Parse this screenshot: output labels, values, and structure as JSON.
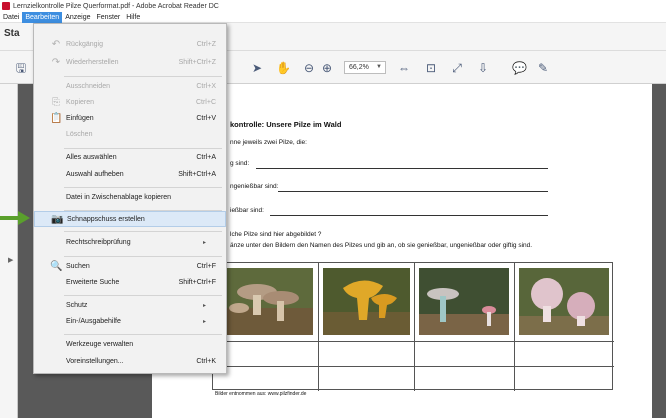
{
  "window": {
    "title": "Lernzielkontrolle Pilze Querformat.pdf - Adobe Acrobat Reader DC"
  },
  "menubar": {
    "items": [
      "Datei",
      "Bearbeiten",
      "Anzeige",
      "Fenster",
      "Hilfe"
    ],
    "active": "Bearbeiten"
  },
  "tabrow": {
    "label": "Sta"
  },
  "toolbar": {
    "zoom": "66,2%"
  },
  "dropdown": {
    "items": [
      {
        "label": "Rückgängig",
        "shortcut": "Ctrl+Z",
        "disabled": true,
        "icon": "undo-icon"
      },
      {
        "label": "Wiederherstellen",
        "shortcut": "Shift+Ctrl+Z",
        "disabled": true,
        "icon": "redo-icon"
      },
      {
        "label": "Ausschneiden",
        "shortcut": "Ctrl+X",
        "disabled": true
      },
      {
        "label": "Kopieren",
        "shortcut": "Ctrl+C",
        "disabled": true,
        "icon": "copy-icon"
      },
      {
        "label": "Einfügen",
        "shortcut": "Ctrl+V",
        "disabled": false,
        "icon": "paste-icon"
      },
      {
        "label": "Löschen",
        "shortcut": "",
        "disabled": true
      },
      {
        "label": "Alles auswählen",
        "shortcut": "Ctrl+A",
        "disabled": false
      },
      {
        "label": "Auswahl aufheben",
        "shortcut": "Shift+Ctrl+A",
        "disabled": false
      },
      {
        "label": "Datei in Zwischenablage kopieren",
        "shortcut": "",
        "disabled": false
      },
      {
        "label": "Schnappschuss erstellen",
        "shortcut": "",
        "disabled": false,
        "icon": "camera-icon",
        "highlight": true
      },
      {
        "label": "Rechtschreibprüfung",
        "shortcut": "",
        "disabled": false,
        "submenu": true
      },
      {
        "label": "Suchen",
        "shortcut": "Ctrl+F",
        "disabled": false,
        "icon": "search-icon"
      },
      {
        "label": "Erweiterte Suche",
        "shortcut": "Shift+Ctrl+F",
        "disabled": false
      },
      {
        "label": "Schutz",
        "shortcut": "",
        "disabled": false,
        "submenu": true
      },
      {
        "label": "Ein-/Ausgabehilfe",
        "shortcut": "",
        "disabled": false,
        "submenu": true
      },
      {
        "label": "Werkzeuge verwalten",
        "shortcut": "",
        "disabled": false
      },
      {
        "label": "Voreinstellungen...",
        "shortcut": "Ctrl+K",
        "disabled": false
      }
    ]
  },
  "document": {
    "title": "kontrolle: Unsere Pilze im Wald",
    "intro": "nne jeweils zwei Pilze, die:",
    "line1": "g sind:",
    "line2": "ngenießbar sind:",
    "line3": "ießbar sind:",
    "q2": "lche Pilze sind hier abgebildet ?",
    "q2b": "änze unter den Bildern den Namen des Pilzes und gib an, ob sie genießbar, ungenießbar oder giftig sind.",
    "credit": "Bilder entnommen aus: www.pilzfinder.de"
  },
  "colors": {
    "menu_active": "#3d8ee0",
    "highlight": "#dce9f7",
    "arrow": "#5aa02c",
    "title_icon": "#c8102e"
  }
}
